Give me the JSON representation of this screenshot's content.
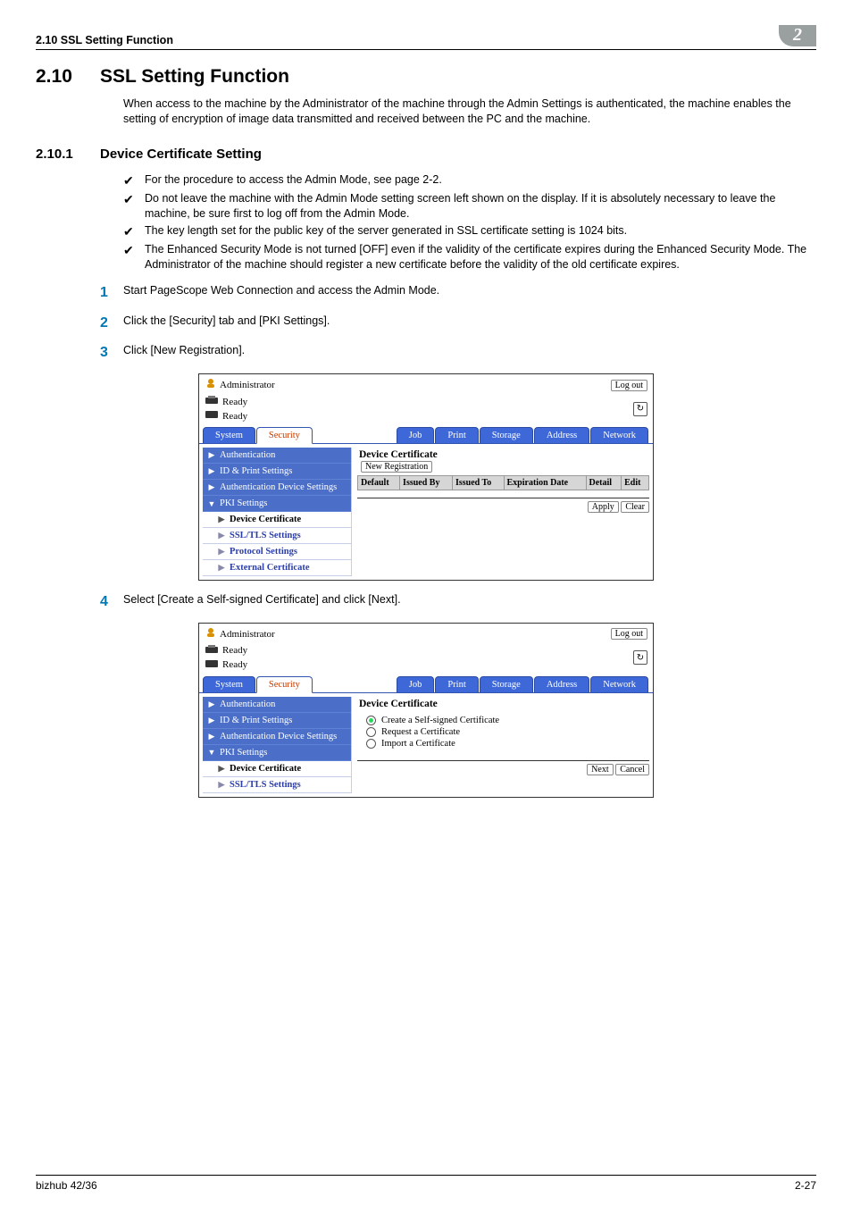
{
  "header": {
    "running_head": "2.10    SSL Setting Function",
    "chapter_number": "2"
  },
  "section": {
    "number": "2.10",
    "title": "SSL Setting Function",
    "intro": "When access to the machine by the Administrator of the machine through the Admin Settings is authenticated, the machine enables the setting of encryption of image data transmitted and received between the PC and the machine."
  },
  "subsection": {
    "number": "2.10.1",
    "title": "Device Certificate Setting"
  },
  "checks": [
    "For the procedure to access the Admin Mode, see page 2-2.",
    "Do not leave the machine with the Admin Mode setting screen left shown on the display. If it is absolutely necessary to leave the machine, be sure first to log off from the Admin Mode.",
    "The key length set for the public key of the server generated in SSL certificate setting is 1024 bits.",
    "The Enhanced Security Mode is not turned [OFF] even if the validity of the certificate expires during the Enhanced Security Mode. The Administrator of the machine should register a new certificate before the validity of the old certificate expires."
  ],
  "steps": [
    "Start PageScope Web Connection and access the Admin Mode.",
    "Click the [Security] tab and [PKI Settings].",
    "Click [New Registration].",
    "Select [Create a Self-signed Certificate] and click [Next]."
  ],
  "ui": {
    "admin_label": "Administrator",
    "logout": "Log out",
    "status1": "Ready",
    "status2": "Ready",
    "tabs_left": [
      "System",
      "Security"
    ],
    "tabs_right": [
      "Job",
      "Print",
      "Storage",
      "Address",
      "Network"
    ],
    "side_items": [
      "Authentication",
      "ID & Print Settings",
      "Authentication Device Settings",
      "PKI Settings"
    ],
    "side_sub": [
      "Device Certificate",
      "SSL/TLS Settings",
      "Protocol Settings",
      "External Certificate"
    ],
    "panel1": {
      "title": "Device Certificate",
      "new_reg": "New Registration",
      "cols": [
        "Default",
        "Issued By",
        "Issued To",
        "Expiration Date",
        "Detail",
        "Edit"
      ],
      "apply": "Apply",
      "clear": "Clear"
    },
    "panel2": {
      "title": "Device Certificate",
      "opts": [
        "Create a Self-signed Certificate",
        "Request a Certificate",
        "Import a Certificate"
      ],
      "next": "Next",
      "cancel": "Cancel"
    }
  },
  "chart_data": {
    "type": "table",
    "title": "Device Certificate",
    "columns": [
      "Default",
      "Issued By",
      "Issued To",
      "Expiration Date",
      "Detail",
      "Edit"
    ],
    "rows": []
  },
  "footer": {
    "left": "bizhub 42/36",
    "right": "2-27"
  }
}
